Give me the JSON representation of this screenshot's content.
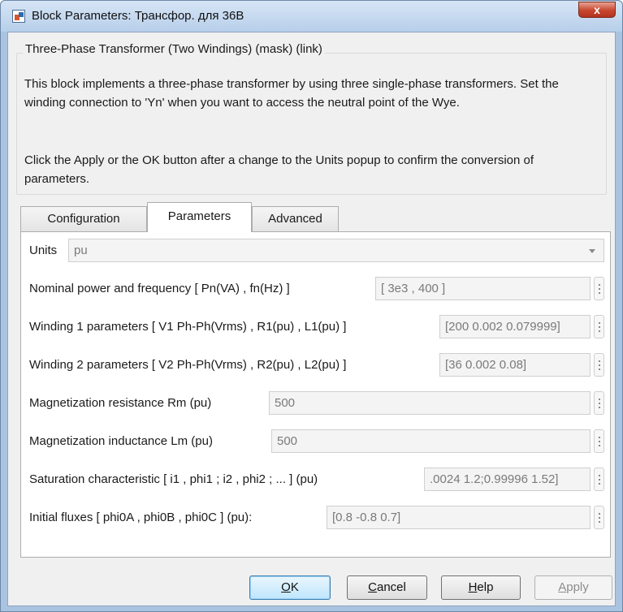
{
  "window": {
    "title": "Block Parameters: Трансфор. для 36В",
    "close_label": "x"
  },
  "block": {
    "group_title": "Three-Phase Transformer (Two Windings) (mask) (link)",
    "description_1": "This block implements a three-phase transformer by using three single-phase transformers. Set the winding connection to 'Yn'  when you want to access the neutral point of the Wye.",
    "description_2": "Click the Apply or the OK button after a change to the Units popup to confirm the conversion of parameters."
  },
  "tabs": [
    {
      "label": "Configuration",
      "active": false
    },
    {
      "label": "Parameters",
      "active": true
    },
    {
      "label": "Advanced",
      "active": false
    }
  ],
  "params": {
    "units": {
      "label": "Units",
      "value": "pu"
    },
    "nominal": {
      "label": "Nominal power and frequency  [ Pn(VA) , fn(Hz) ]",
      "value": "[ 3e3 , 400 ]"
    },
    "winding1": {
      "label": "Winding 1 parameters [ V1 Ph-Ph(Vrms) , R1(pu) , L1(pu) ]",
      "value": "[200 0.002 0.079999]"
    },
    "winding2": {
      "label": "Winding 2 parameters [ V2 Ph-Ph(Vrms) , R2(pu) , L2(pu) ]",
      "value": "[36 0.002 0.08]"
    },
    "rm": {
      "label": "Magnetization resistance  Rm (pu)",
      "value": "500"
    },
    "lm": {
      "label": "Magnetization inductance  Lm (pu)",
      "value": "500"
    },
    "saturation": {
      "label": "Saturation characteristic [ i1 ,  phi1 ;  i2 , phi2 ; ... ] (pu)",
      "value": ".0024 1.2;0.99996 1.52]"
    },
    "fluxes": {
      "label": "Initial fluxes [ phi0A , phi0B , phi0C ] (pu):",
      "value": "[0.8 -0.8 0.7]"
    }
  },
  "buttons": {
    "ok": {
      "mnemonic": "O",
      "rest": "K"
    },
    "cancel": {
      "mnemonic": "C",
      "rest": "ancel"
    },
    "help": {
      "mnemonic": "H",
      "rest": "elp"
    },
    "apply": {
      "mnemonic": "A",
      "rest": "pply"
    }
  }
}
